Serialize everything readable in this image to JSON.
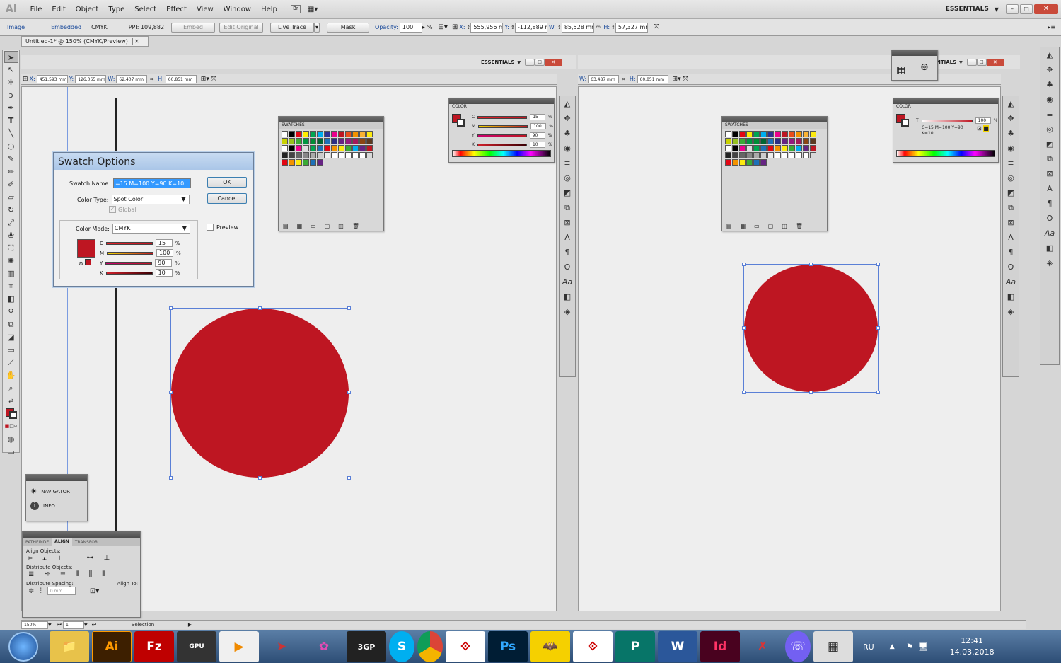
{
  "menubar": {
    "logo": "Ai",
    "items": [
      "File",
      "Edit",
      "Object",
      "Type",
      "Select",
      "Effect",
      "View",
      "Window",
      "Help"
    ],
    "workspace": "ESSENTIALS"
  },
  "control": {
    "image": "Image",
    "embedded": "Embedded",
    "mode": "CMYK",
    "ppi": "PPI: 109,882",
    "embed": "Embed",
    "edit_original": "Edit Original",
    "live_trace": "Live Trace",
    "mask": "Mask",
    "opacity_label": "Opacity:",
    "opacity": "100",
    "percent": "%",
    "x_label": "X:",
    "x": "555,956 mm",
    "y_label": "Y:",
    "y": "-112,889 mr",
    "w_label": "W:",
    "w": "85,528 mm",
    "h_label": "H:",
    "h": "57,327 mm"
  },
  "doc": {
    "tab": "Untitled-1* @ 150% (CMYK/Preview)"
  },
  "inner": {
    "x": "451,593 mm",
    "y": "126,065 mm",
    "w": "62,407 mm",
    "h": "60,851 mm",
    "workspace": "ESSENTIALS",
    "right_w": "63,487 mm",
    "right_h": "60,851 mm",
    "right_ws": "NTIALS"
  },
  "swatches": {
    "title": "SWATCHES"
  },
  "color": {
    "title": "COLOR",
    "c": "15",
    "m": "100",
    "y": "90",
    "k": "10",
    "right_text": "C=15 M=100 Y=90 K=10",
    "right_tint": "100"
  },
  "dialog": {
    "title": "Swatch Options",
    "name_label": "Swatch Name:",
    "name_value": "=15 M=100 Y=90 K=10",
    "type_label": "Color Type:",
    "type_value": "Spot Color",
    "global": "Global",
    "mode_label": "Color Mode:",
    "mode_value": "CMYK",
    "preview": "Preview",
    "ok": "OK",
    "cancel": "Cancel",
    "c": "15",
    "m": "100",
    "y": "90",
    "k": "10",
    "pct": "%"
  },
  "navigator": {
    "nav": "NAVIGATOR",
    "info": "INFO"
  },
  "align": {
    "tabs": [
      "PATHFINDE",
      "ALIGN",
      "TRANSFOR"
    ],
    "align_objects": "Align Objects:",
    "distribute_objects": "Distribute Objects:",
    "distribute_spacing": "Distribute Spacing:",
    "align_to": "Align To:",
    "spacing": "0 mm"
  },
  "status": {
    "zoom": "150%",
    "page": "1",
    "tool": "Selection"
  },
  "taskbar": {
    "lang": "RU",
    "time": "12:41",
    "date": "14.03.2018"
  },
  "colors": {
    "fill": "#be1622"
  }
}
